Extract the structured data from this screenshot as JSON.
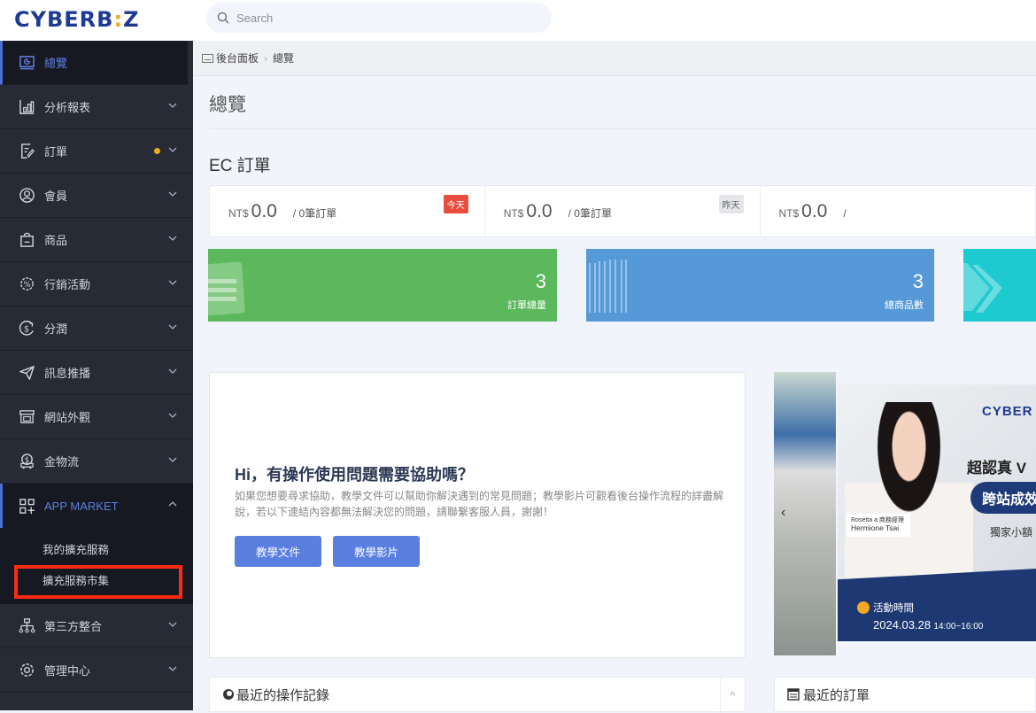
{
  "brand": {
    "logo_main": "CYBERB",
    "logo_i": ":",
    "logo_end": "Z"
  },
  "search": {
    "placeholder": "Search"
  },
  "sidebar": {
    "items": [
      {
        "label": "總覽",
        "icon": "dashboard-icon",
        "active": true
      },
      {
        "label": "分析報表",
        "icon": "bar-chart-icon"
      },
      {
        "label": "訂單",
        "icon": "order-edit-icon",
        "notification_dot": true
      },
      {
        "label": "會員",
        "icon": "user-circle-icon"
      },
      {
        "label": "商品",
        "icon": "shopping-bag-icon"
      },
      {
        "label": "行銷活動",
        "icon": "discount-badge-icon"
      },
      {
        "label": "分潤",
        "icon": "dollar-refresh-icon"
      },
      {
        "label": "訊息推播",
        "icon": "paper-plane-icon"
      },
      {
        "label": "網站外觀",
        "icon": "storefront-icon"
      },
      {
        "label": "金物流",
        "icon": "delivery-truck-icon"
      },
      {
        "label": "APP MARKET",
        "icon": "app-grid-plus-icon",
        "expanded": true
      },
      {
        "label": "第三方整合",
        "icon": "network-icon"
      },
      {
        "label": "管理中心",
        "icon": "gear-icon"
      }
    ],
    "app_market_sub": [
      {
        "label": "我的擴充服務"
      },
      {
        "label": "擴充服務市集",
        "highlighted": true
      }
    ]
  },
  "breadcrumb": {
    "root": "後台面板",
    "current": "總覽"
  },
  "page": {
    "title": "總覽",
    "section_title": "EC 訂單"
  },
  "stats": [
    {
      "currency": "NT$",
      "amount": "0.0",
      "orders": "/ 0筆訂單",
      "badge": "今天"
    },
    {
      "currency": "NT$",
      "amount": "0.0",
      "orders": "/ 0筆訂單",
      "badge": "昨天"
    },
    {
      "currency": "NT$",
      "amount": "0.0",
      "orders": "/"
    }
  ],
  "tiles": [
    {
      "value": "3",
      "label": "訂單總量",
      "color": "#5cb85c"
    },
    {
      "value": "3",
      "label": "總商品數",
      "color": "#5599d8"
    },
    {
      "value": "",
      "label": "",
      "color": "#1ccad0"
    }
  ],
  "help": {
    "title": "Hi，有操作使用問題需要協助嗎？",
    "body": "如果您想要尋求協助，教學文件可以幫助你解決遇到的常見問題；教學影片可觀看後台操作流程的詳盡解說，若以下連結內容都無法解決您的問題，請聯繫客服人員，謝謝！",
    "btn_docs": "教學文件",
    "btn_videos": "教學影片"
  },
  "banner": {
    "brand": "CYBER",
    "headline": "超認真 V",
    "pill": "跨站成效",
    "sub": "獨家小額",
    "speaker_role": "Rosetta a 商務經理",
    "speaker_name": "Hermione Tsai",
    "event_label": "活動時間",
    "event_date": "2024.03.28",
    "event_time": "14:00~16:00",
    "prev_label": "‹"
  },
  "panels": {
    "recent_ops": "最近的操作記錄",
    "recent_orders": "最近的訂單",
    "collapse": "^"
  }
}
